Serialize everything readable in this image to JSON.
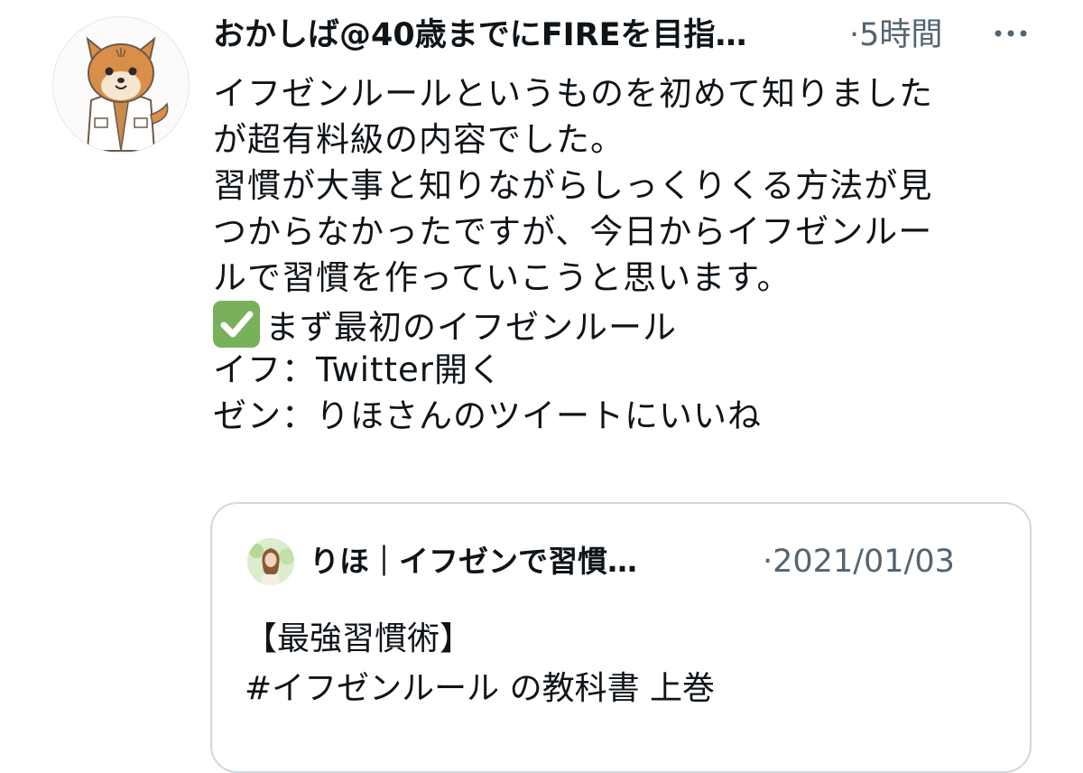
{
  "tweet": {
    "author_name": "おかしば@40歳までにFIREを目指…",
    "separator": "·",
    "time": "5時間",
    "more_icon": "more-horizontal-icon",
    "lines": [
      "イフゼンルールというものを初めて知りました",
      "が超有料級の内容でした。",
      "習慣が大事と知りながらしっくりくる方法が見",
      "つからなかったですが、今日からイフゼンルー",
      "ルで習慣を作っていこうと思います。",
      "まず最初のイフゼンルール",
      "イフ：Twitter開く",
      "ゼン：りほさんのツイートにいいね"
    ],
    "check_icon": "check-mark-button-icon"
  },
  "quote": {
    "author_name": "りほ｜イフゼンで習慣…",
    "separator": "·",
    "date": "2021/01/03",
    "lines": [
      "【最強習慣術】",
      "#イフゼンルール の教科書 上巻"
    ]
  },
  "colors": {
    "text": "#0f1419",
    "muted": "#536471",
    "border": "#cfd9de",
    "check_green": "#78b159"
  }
}
